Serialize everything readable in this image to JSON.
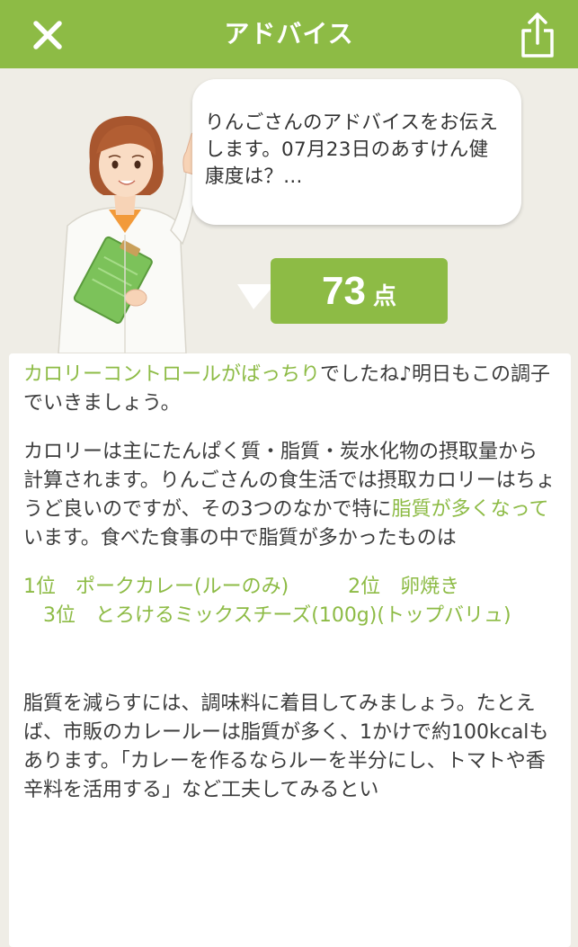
{
  "header": {
    "title": "アドバイス",
    "close_icon": "close-icon",
    "share_icon": "share-icon"
  },
  "advice": {
    "bubble_text": "りんごさんのアドバイスをお伝えします。07月23日のあすけん健康度は？...",
    "score": "73",
    "score_unit": "点"
  },
  "content": {
    "p1_highlight": "カロリーコントロールがばっちり",
    "p1_rest": "でしたね♪明日もこの調子でいきましょう。",
    "p2_before": "カロリーは主にたんぱく質・脂質・炭水化物の摂取量から計算されます。りんごさんの食生活では摂取カロリーはちょうど良いのですが、その3つのなかで特に",
    "p2_highlight": "脂質が多くなって",
    "p2_after": "います。食べた食事の中で脂質が多かったものは",
    "ranking_line1": "1位　ポークカレー(ルーのみ)　　　2位　卵焼き",
    "ranking_line2": "　3位　とろけるミックスチーズ(100g)(トップバリュ)",
    "p3": "脂質を減らすには、調味料に着目してみましょう。たとえば、市販のカレールーは脂質が多く、1かけで約100kcalもあります。「カレーを作るならルーを半分にし、トマトや香辛料を活用する」など工夫してみるとい"
  },
  "colors": {
    "brand_green": "#8dbb45",
    "background": "#efede6"
  }
}
